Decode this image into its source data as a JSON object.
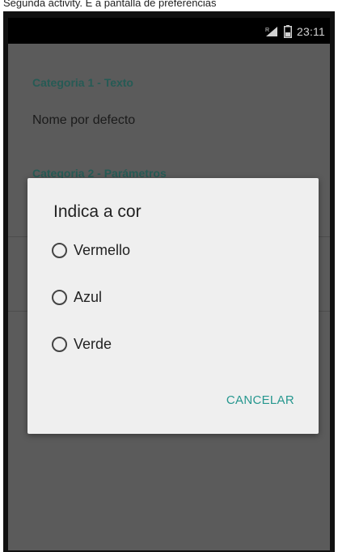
{
  "caption": "Segunda activity. É a pantalla de preferencias",
  "status_bar": {
    "time": "23:11",
    "signal_icon": "signal-icon",
    "battery_icon": "battery-icon"
  },
  "preferences": {
    "category_1_title": "Categoria 1 - Texto",
    "item_1_value": "Nome por defecto",
    "category_2_title": "Categoria 2 - Parámetros"
  },
  "dialog": {
    "title": "Indica a cor",
    "options": [
      {
        "label": "Vermello",
        "selected": false
      },
      {
        "label": "Azul",
        "selected": false
      },
      {
        "label": "Verde",
        "selected": false
      }
    ],
    "cancel_label": "CANCELAR"
  },
  "colors": {
    "accent": "#26978f",
    "category_text": "#2f6f68",
    "dialog_background": "#efefef",
    "status_bar": "#000000"
  }
}
